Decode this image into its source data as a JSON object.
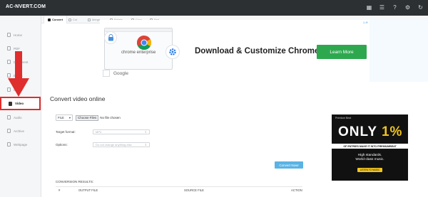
{
  "app": {
    "logo": "AC▫NVERT.COM"
  },
  "top_icons": [
    "grid-icon",
    "list-icon",
    "help-icon",
    "settings-icon",
    "refresh-icon"
  ],
  "tabs": [
    {
      "label": "Convert",
      "active": true
    },
    {
      "label": "Cut",
      "active": false
    },
    {
      "label": "Merge",
      "active": false
    },
    {
      "label": "Rotate",
      "active": false
    },
    {
      "label": "Crop",
      "active": false
    },
    {
      "label": "Pad",
      "active": false
    }
  ],
  "sidebar": {
    "items": [
      {
        "label": "Home",
        "icon": "home-icon"
      },
      {
        "label": "PDF",
        "icon": "pdf-icon"
      },
      {
        "label": "Document",
        "icon": "document-icon"
      },
      {
        "label": "Ebook",
        "icon": "ebook-icon"
      },
      {
        "label": "Image",
        "icon": "image-icon"
      },
      {
        "label": "Video",
        "icon": "video-icon",
        "active": true
      },
      {
        "label": "Audio",
        "icon": "audio-icon"
      },
      {
        "label": "Archive",
        "icon": "archive-icon"
      },
      {
        "label": "Webpage",
        "icon": "webpage-icon"
      }
    ]
  },
  "ad_banner": {
    "browser_label": "chrome enterprise",
    "headline": "Download & Customize Chrome",
    "cta": "Learn More",
    "advertiser": "Google",
    "badge": "▷✕"
  },
  "converter": {
    "title": "Convert video online",
    "file_source": "FILE",
    "choose_files": "Choose Files",
    "no_file": "No file chosen",
    "target_format_label": "Target format:",
    "target_format_value": "MP4",
    "options_label": "Options:",
    "options_value": "Do not change anything else",
    "convert_button": "Convert Now!",
    "results_title": "CONVERSION RESULTS:",
    "columns": [
      "#",
      "OUTPUT FILE",
      "SOURCE FILE",
      "ACTION"
    ]
  },
  "side_ad": {
    "brand": "Premium Beat",
    "only": "ONLY ",
    "percent": "1%",
    "strip": "OF ENTRIES MAKE IT INTO PREMIUMBEAT",
    "sub1": "High standards.",
    "sub2": "World-class music.",
    "cta": "LISTEN TO MUSIC"
  },
  "colors": {
    "topbar": "#2c3033",
    "highlight": "#e02d2d",
    "cta_green": "#2ea84f",
    "convert_blue": "#5ab3e4",
    "ad_gold": "#f0c320"
  }
}
